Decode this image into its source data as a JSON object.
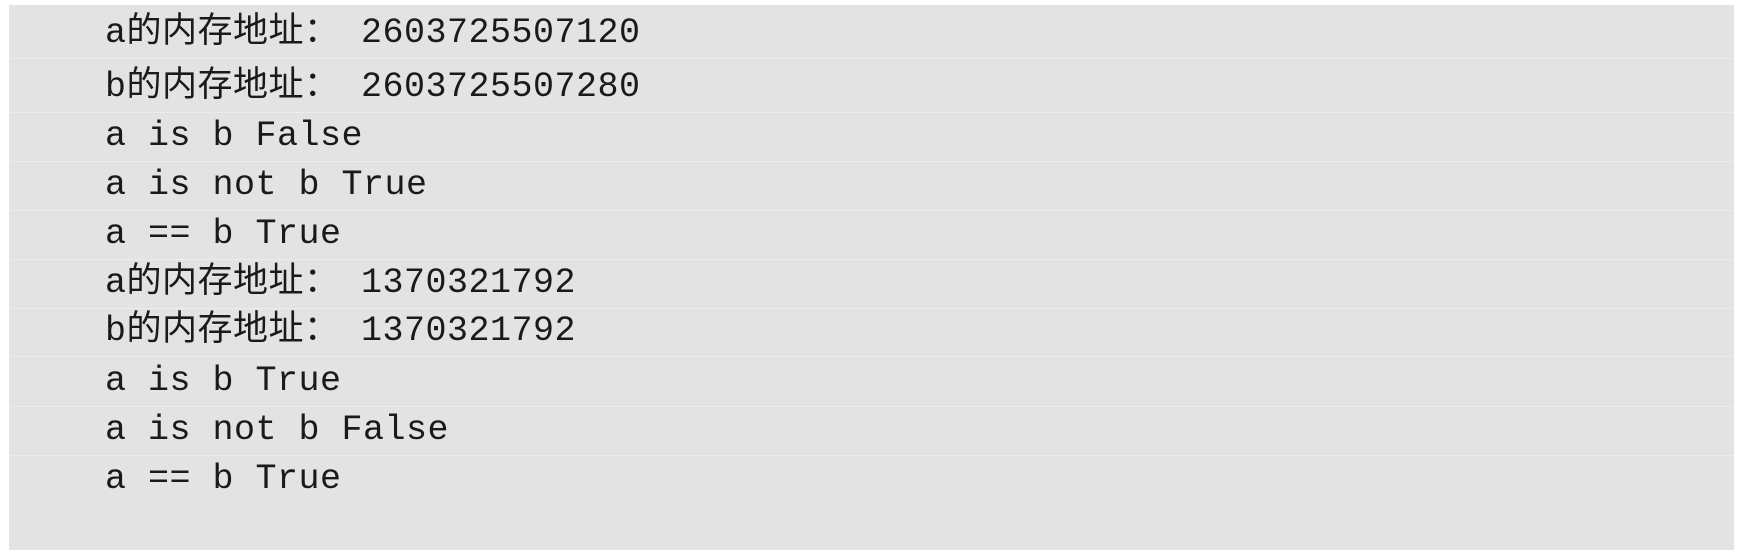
{
  "console": {
    "lines": [
      "a的内存地址： 2603725507120",
      "b的内存地址： 2603725507280",
      "a is b False",
      "a is not b True",
      "a == b True",
      "a的内存地址： 1370321792",
      "b的内存地址： 1370321792",
      "a is b True",
      "a is not b False",
      "a == b True"
    ]
  }
}
